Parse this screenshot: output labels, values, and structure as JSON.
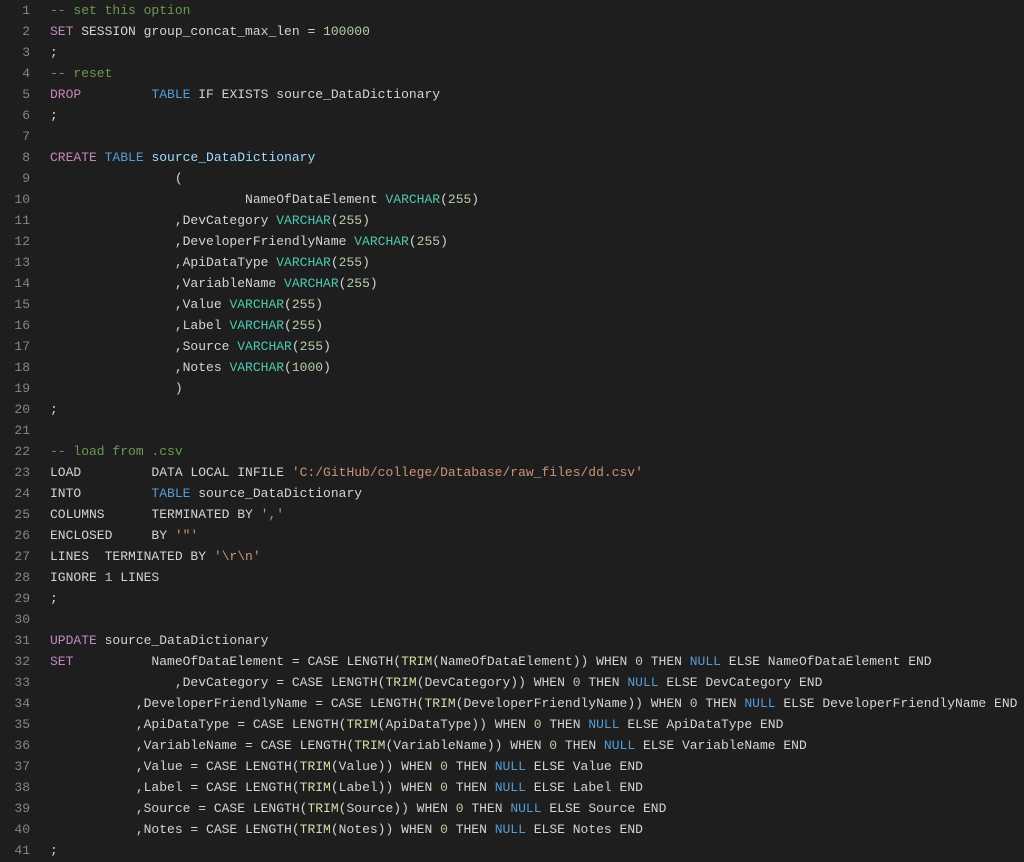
{
  "editor": {
    "language": "sql",
    "lines": [
      {
        "n": 1,
        "t": [
          [
            "comment",
            "-- set this option"
          ]
        ]
      },
      {
        "n": 2,
        "t": [
          [
            "kw",
            "SET"
          ],
          [
            "op",
            " SESSION group_concat_max_len "
          ],
          [
            "op",
            "="
          ],
          [
            "op",
            " "
          ],
          [
            "num",
            "100000"
          ]
        ]
      },
      {
        "n": 3,
        "t": [
          [
            "op",
            ";"
          ]
        ]
      },
      {
        "n": 4,
        "t": [
          [
            "comment",
            "-- reset"
          ]
        ]
      },
      {
        "n": 5,
        "t": [
          [
            "kw",
            "DROP"
          ],
          [
            "op",
            "         "
          ],
          [
            "kw2",
            "TABLE"
          ],
          [
            "op",
            " IF EXISTS source_DataDictionary"
          ]
        ]
      },
      {
        "n": 6,
        "t": [
          [
            "op",
            ";"
          ]
        ]
      },
      {
        "n": 7,
        "t": []
      },
      {
        "n": 8,
        "t": [
          [
            "kw",
            "CREATE"
          ],
          [
            "op",
            " "
          ],
          [
            "kw2",
            "TABLE"
          ],
          [
            "op",
            " "
          ],
          [
            "ident",
            "source_DataDictionary"
          ]
        ]
      },
      {
        "n": 9,
        "t": [
          [
            "op",
            "                ("
          ]
        ]
      },
      {
        "n": 10,
        "t": [
          [
            "op",
            "                         NameOfDataElement "
          ],
          [
            "type",
            "VARCHAR"
          ],
          [
            "op",
            "("
          ],
          [
            "num",
            "255"
          ],
          [
            "op",
            ")"
          ]
        ]
      },
      {
        "n": 11,
        "t": [
          [
            "op",
            "                ,DevCategory "
          ],
          [
            "type",
            "VARCHAR"
          ],
          [
            "op",
            "("
          ],
          [
            "num",
            "255"
          ],
          [
            "op",
            ")"
          ]
        ]
      },
      {
        "n": 12,
        "t": [
          [
            "op",
            "                ,DeveloperFriendlyName "
          ],
          [
            "type",
            "VARCHAR"
          ],
          [
            "op",
            "("
          ],
          [
            "num",
            "255"
          ],
          [
            "op",
            ")"
          ]
        ]
      },
      {
        "n": 13,
        "t": [
          [
            "op",
            "                ,ApiDataType "
          ],
          [
            "type",
            "VARCHAR"
          ],
          [
            "op",
            "("
          ],
          [
            "num",
            "255"
          ],
          [
            "op",
            ")"
          ]
        ]
      },
      {
        "n": 14,
        "t": [
          [
            "op",
            "                ,VariableName "
          ],
          [
            "type",
            "VARCHAR"
          ],
          [
            "op",
            "("
          ],
          [
            "num",
            "255"
          ],
          [
            "op",
            ")"
          ]
        ]
      },
      {
        "n": 15,
        "t": [
          [
            "op",
            "                ,Value "
          ],
          [
            "type",
            "VARCHAR"
          ],
          [
            "op",
            "("
          ],
          [
            "num",
            "255"
          ],
          [
            "op",
            ")"
          ]
        ]
      },
      {
        "n": 16,
        "t": [
          [
            "op",
            "                ,Label "
          ],
          [
            "type",
            "VARCHAR"
          ],
          [
            "op",
            "("
          ],
          [
            "num",
            "255"
          ],
          [
            "op",
            ")"
          ]
        ]
      },
      {
        "n": 17,
        "t": [
          [
            "op",
            "                ,Source "
          ],
          [
            "type",
            "VARCHAR"
          ],
          [
            "op",
            "("
          ],
          [
            "num",
            "255"
          ],
          [
            "op",
            ")"
          ]
        ]
      },
      {
        "n": 18,
        "t": [
          [
            "op",
            "                ,Notes "
          ],
          [
            "type",
            "VARCHAR"
          ],
          [
            "op",
            "("
          ],
          [
            "num",
            "1000"
          ],
          [
            "op",
            ")"
          ]
        ]
      },
      {
        "n": 19,
        "t": [
          [
            "op",
            "                )"
          ]
        ]
      },
      {
        "n": 20,
        "t": [
          [
            "op",
            ";"
          ]
        ]
      },
      {
        "n": 21,
        "t": []
      },
      {
        "n": 22,
        "t": [
          [
            "comment",
            "-- load from .csv"
          ]
        ]
      },
      {
        "n": 23,
        "t": [
          [
            "op",
            "LOAD         DATA LOCAL INFILE "
          ],
          [
            "str",
            "'C:/GitHub/college/Database/raw_files/dd.csv'"
          ]
        ]
      },
      {
        "n": 24,
        "t": [
          [
            "op",
            "INTO         "
          ],
          [
            "kw2",
            "TABLE"
          ],
          [
            "op",
            " source_DataDictionary"
          ]
        ]
      },
      {
        "n": 25,
        "t": [
          [
            "op",
            "COLUMNS      TERMINATED BY "
          ],
          [
            "str",
            "','"
          ]
        ]
      },
      {
        "n": 26,
        "t": [
          [
            "op",
            "ENCLOSED     BY "
          ],
          [
            "str",
            "'\"'"
          ]
        ]
      },
      {
        "n": 27,
        "t": [
          [
            "op",
            "LINES  TERMINATED BY "
          ],
          [
            "str",
            "'\\r\\n'"
          ]
        ]
      },
      {
        "n": 28,
        "t": [
          [
            "op",
            "IGNORE "
          ],
          [
            "num",
            "1"
          ],
          [
            "op",
            " LINES"
          ]
        ]
      },
      {
        "n": 29,
        "t": [
          [
            "op",
            ";"
          ]
        ]
      },
      {
        "n": 30,
        "t": []
      },
      {
        "n": 31,
        "t": [
          [
            "kw",
            "UPDATE"
          ],
          [
            "op",
            " source_DataDictionary"
          ]
        ]
      },
      {
        "n": 32,
        "t": [
          [
            "kw",
            "SET"
          ],
          [
            "op",
            "          NameOfDataElement = CASE LENGTH("
          ],
          [
            "func",
            "TRIM"
          ],
          [
            "op",
            "(NameOfDataElement)) WHEN "
          ],
          [
            "num",
            "0"
          ],
          [
            "op",
            " THEN "
          ],
          [
            "null",
            "NULL"
          ],
          [
            "op",
            " ELSE NameOfDataElement END"
          ]
        ]
      },
      {
        "n": 33,
        "t": [
          [
            "op",
            "                ,DevCategory = CASE LENGTH("
          ],
          [
            "func",
            "TRIM"
          ],
          [
            "op",
            "(DevCategory)) WHEN "
          ],
          [
            "num",
            "0"
          ],
          [
            "op",
            " THEN "
          ],
          [
            "null",
            "NULL"
          ],
          [
            "op",
            " ELSE DevCategory END"
          ]
        ]
      },
      {
        "n": 34,
        "t": [
          [
            "op",
            "           ,DeveloperFriendlyName = CASE LENGTH("
          ],
          [
            "func",
            "TRIM"
          ],
          [
            "op",
            "(DeveloperFriendlyName)) WHEN "
          ],
          [
            "num",
            "0"
          ],
          [
            "op",
            " THEN "
          ],
          [
            "null",
            "NULL"
          ],
          [
            "op",
            " ELSE DeveloperFriendlyName END"
          ]
        ]
      },
      {
        "n": 35,
        "t": [
          [
            "op",
            "           ,ApiDataType = CASE LENGTH("
          ],
          [
            "func",
            "TRIM"
          ],
          [
            "op",
            "(ApiDataType)) WHEN "
          ],
          [
            "num",
            "0"
          ],
          [
            "op",
            " THEN "
          ],
          [
            "null",
            "NULL"
          ],
          [
            "op",
            " ELSE ApiDataType END"
          ]
        ]
      },
      {
        "n": 36,
        "t": [
          [
            "op",
            "           ,VariableName = CASE LENGTH("
          ],
          [
            "func",
            "TRIM"
          ],
          [
            "op",
            "(VariableName)) WHEN "
          ],
          [
            "num",
            "0"
          ],
          [
            "op",
            " THEN "
          ],
          [
            "null",
            "NULL"
          ],
          [
            "op",
            " ELSE VariableName END"
          ]
        ]
      },
      {
        "n": 37,
        "t": [
          [
            "op",
            "           ,Value = CASE LENGTH("
          ],
          [
            "func",
            "TRIM"
          ],
          [
            "op",
            "(Value)) WHEN "
          ],
          [
            "num",
            "0"
          ],
          [
            "op",
            " THEN "
          ],
          [
            "null",
            "NULL"
          ],
          [
            "op",
            " ELSE Value END"
          ]
        ]
      },
      {
        "n": 38,
        "t": [
          [
            "op",
            "           ,Label = CASE LENGTH("
          ],
          [
            "func",
            "TRIM"
          ],
          [
            "op",
            "(Label)) WHEN "
          ],
          [
            "num",
            "0"
          ],
          [
            "op",
            " THEN "
          ],
          [
            "null",
            "NULL"
          ],
          [
            "op",
            " ELSE Label END"
          ]
        ]
      },
      {
        "n": 39,
        "t": [
          [
            "op",
            "           ,Source = CASE LENGTH("
          ],
          [
            "func",
            "TRIM"
          ],
          [
            "op",
            "(Source)) WHEN "
          ],
          [
            "num",
            "0"
          ],
          [
            "op",
            " THEN "
          ],
          [
            "null",
            "NULL"
          ],
          [
            "op",
            " ELSE Source END"
          ]
        ]
      },
      {
        "n": 40,
        "t": [
          [
            "op",
            "           ,Notes = CASE LENGTH("
          ],
          [
            "func",
            "TRIM"
          ],
          [
            "op",
            "(Notes)) WHEN "
          ],
          [
            "num",
            "0"
          ],
          [
            "op",
            " THEN "
          ],
          [
            "null",
            "NULL"
          ],
          [
            "op",
            " ELSE Notes END"
          ]
        ]
      },
      {
        "n": 41,
        "t": [
          [
            "op",
            ";"
          ]
        ]
      }
    ]
  },
  "tokenClass": {
    "comment": "c-comment",
    "kw": "c-kw",
    "kw2": "c-kw2",
    "type": "c-type",
    "ident": "c-ident",
    "func": "c-func",
    "num": "c-num",
    "str": "c-str",
    "op": "c-op",
    "null": "c-null"
  }
}
